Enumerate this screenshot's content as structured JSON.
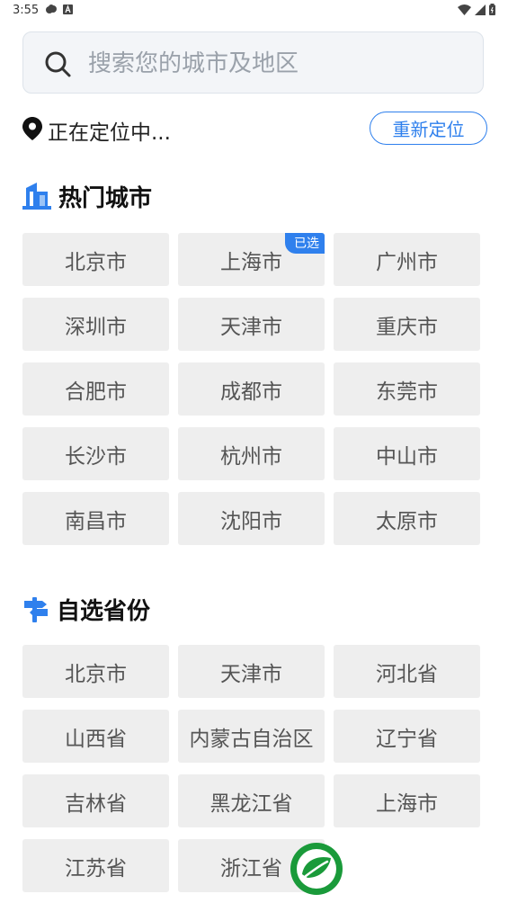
{
  "status_bar": {
    "time": "3:55"
  },
  "search": {
    "placeholder": "搜索您的城市及地区"
  },
  "location": {
    "status": "正在定位中...",
    "relocate_label": "重新定位"
  },
  "hot_cities": {
    "title": "热门城市",
    "items": [
      {
        "label": "北京市"
      },
      {
        "label": "上海市",
        "badge": "已选"
      },
      {
        "label": "广州市"
      },
      {
        "label": "深圳市"
      },
      {
        "label": "天津市"
      },
      {
        "label": "重庆市"
      },
      {
        "label": "合肥市"
      },
      {
        "label": "成都市"
      },
      {
        "label": "东莞市"
      },
      {
        "label": "长沙市"
      },
      {
        "label": "杭州市"
      },
      {
        "label": "中山市"
      },
      {
        "label": "南昌市"
      },
      {
        "label": "沈阳市"
      },
      {
        "label": "太原市"
      }
    ]
  },
  "provinces": {
    "title": "自选省份",
    "items": [
      {
        "label": "北京市"
      },
      {
        "label": "天津市"
      },
      {
        "label": "河北省"
      },
      {
        "label": "山西省"
      },
      {
        "label": "内蒙古自治区"
      },
      {
        "label": "辽宁省"
      },
      {
        "label": "吉林省"
      },
      {
        "label": "黑龙江省"
      },
      {
        "label": "上海市"
      },
      {
        "label": "江苏省"
      },
      {
        "label": "浙江省"
      }
    ]
  },
  "colors": {
    "accent": "#2f80ed",
    "cell_bg": "#eeeeee",
    "logo_green": "#1a9a3a"
  },
  "icons": {
    "search": "search-icon",
    "pin": "location-pin-icon",
    "hot": "building-icon",
    "province": "signpost-icon",
    "logo": "leaf-logo-icon"
  }
}
